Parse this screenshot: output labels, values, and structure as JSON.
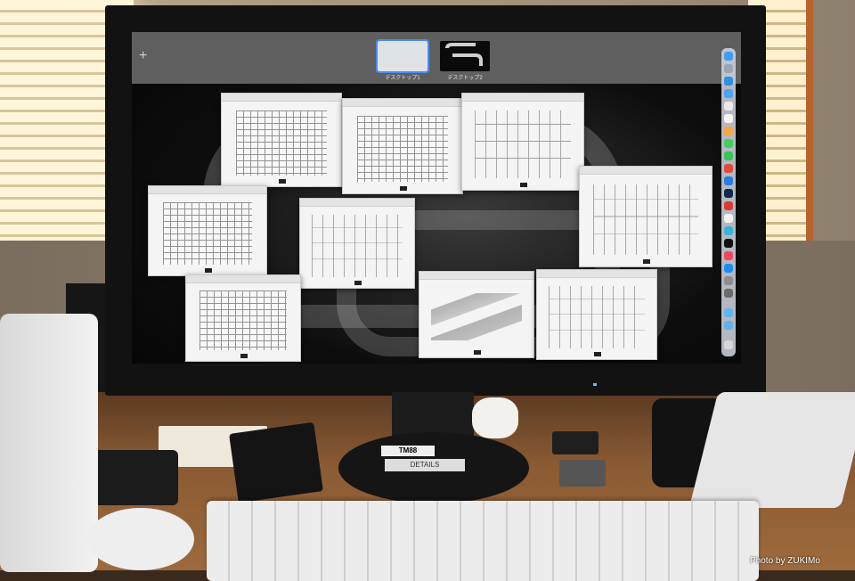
{
  "mission_control": {
    "add_space_icon": "plus-icon",
    "spaces": [
      {
        "label": "デスクトップ1",
        "selected": true
      },
      {
        "label": "デスクトップ2",
        "selected": false
      }
    ]
  },
  "windows": [
    {
      "kind": "floor-plan"
    },
    {
      "kind": "floor-plan"
    },
    {
      "kind": "elevation"
    },
    {
      "kind": "elevation"
    },
    {
      "kind": "floor-plan"
    },
    {
      "kind": "elevation"
    },
    {
      "kind": "floor-plan"
    },
    {
      "kind": "isometric"
    },
    {
      "kind": "elevation"
    }
  ],
  "desk": {
    "stand_label": "TM88",
    "stand_sub_label": "DETAILS"
  },
  "credit": "Photo by ZUKIMo",
  "colors": {
    "selection_outline": "#4a8cf0",
    "desk_wood": "#9d6a3c"
  }
}
